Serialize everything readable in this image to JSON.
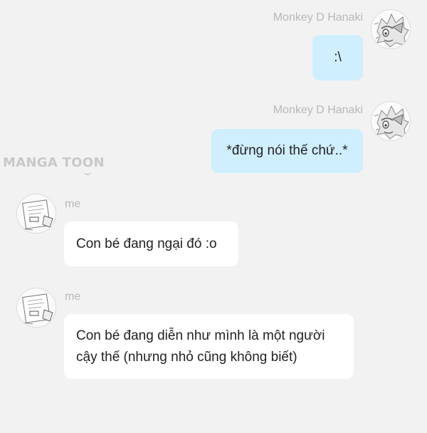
{
  "watermark": {
    "text_part1": "MANGA TO",
    "text_o": "O",
    "text_part2": "N"
  },
  "messages": [
    {
      "sender": "Monkey D Hanaki",
      "text": ":\\",
      "side": "right",
      "avatar_icon": "anime-character-sketch-icon"
    },
    {
      "sender": "Monkey D Hanaki",
      "text": "*đừng nói thế chứ..*",
      "side": "right",
      "avatar_icon": "anime-character-sketch-icon"
    },
    {
      "sender": "me",
      "text": "Con bé đang ngại đó :o",
      "side": "left",
      "avatar_icon": "paper-sketch-icon"
    },
    {
      "sender": "me",
      "text_line1": "Con bé đang diễn như mình là một người",
      "text_line2": "cậy thế (nhưng nhỏ cũng không biết)",
      "side": "left",
      "avatar_icon": "paper-sketch-icon"
    }
  ],
  "colors": {
    "background": "#f2f2f2",
    "outgoing_bubble": "#cfeefe",
    "incoming_bubble": "#ffffff",
    "sender_name": "#b8b8b8"
  }
}
